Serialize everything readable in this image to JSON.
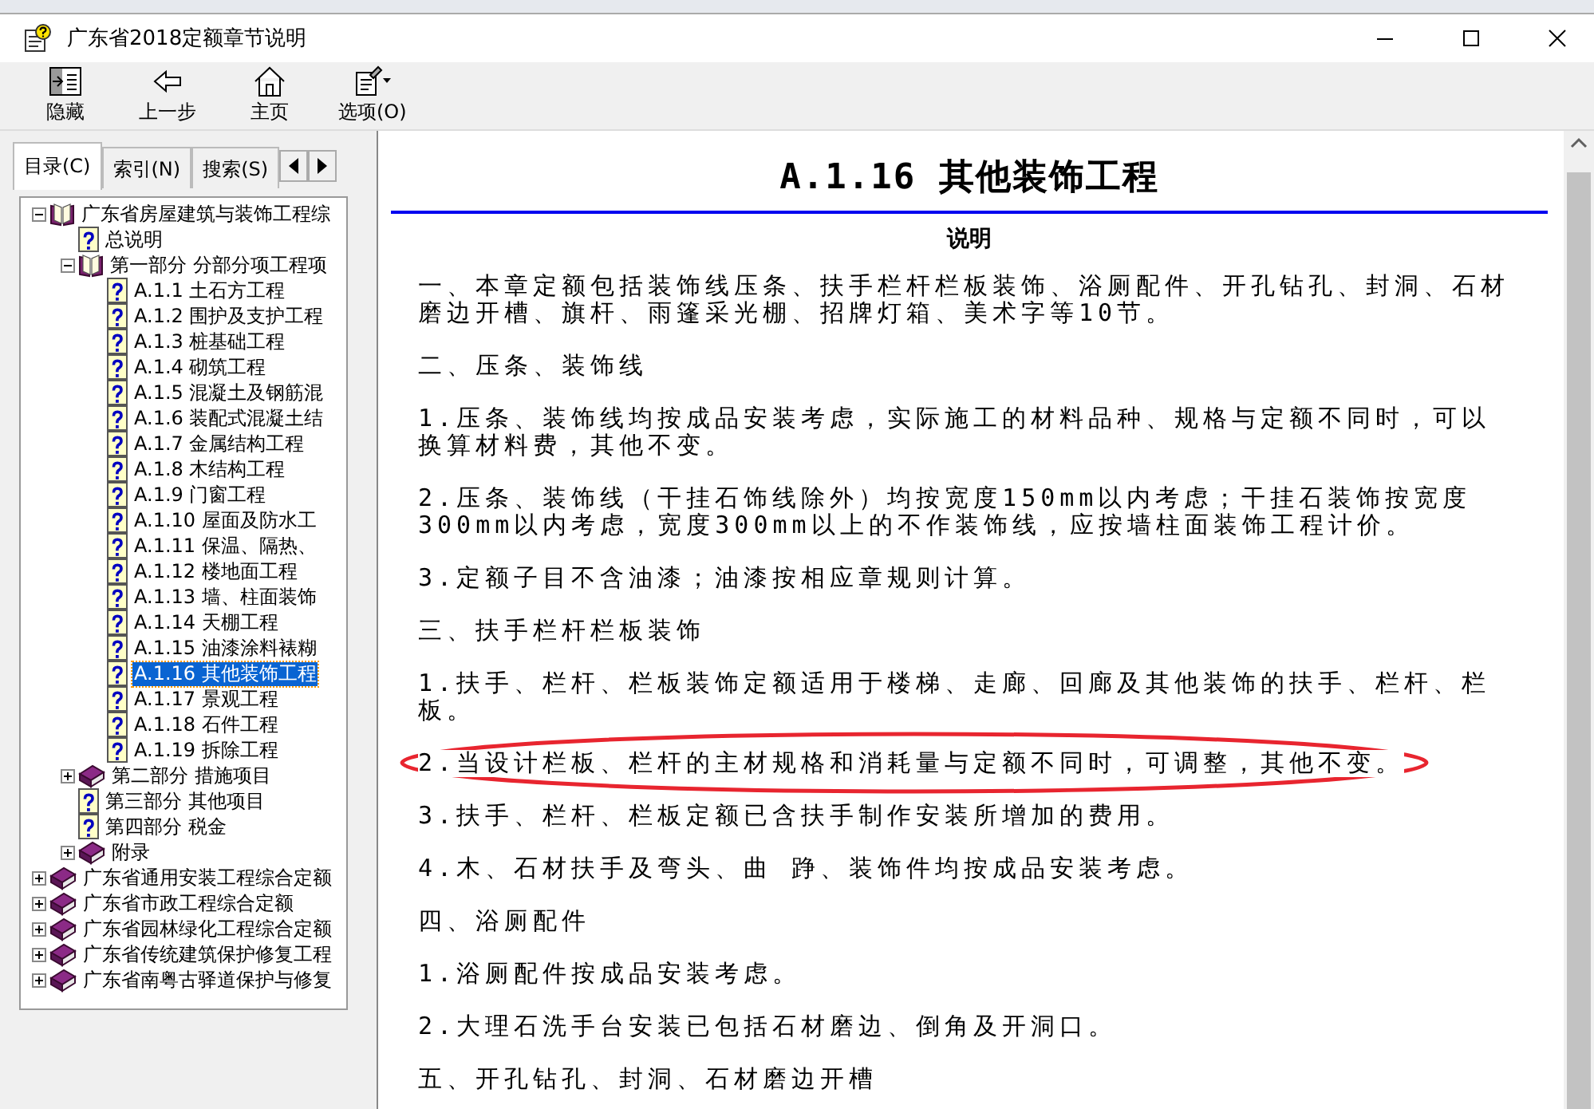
{
  "window": {
    "title": "广东省2018定额章节说明"
  },
  "toolbar": [
    {
      "label": "隐藏",
      "kind": "hide"
    },
    {
      "label": "上一步",
      "kind": "back"
    },
    {
      "label": "主页",
      "kind": "home"
    },
    {
      "label": "选项(O)",
      "kind": "options"
    }
  ],
  "tabs": [
    {
      "label": "目录(C)",
      "selected": true
    },
    {
      "label": "索引(N)",
      "selected": false
    },
    {
      "label": "搜索(S)",
      "selected": false
    }
  ],
  "tree": [
    {
      "label": "广东省房屋建筑与装饰工程综",
      "kind": "book",
      "expanded": true,
      "selected": false,
      "children": [
        {
          "label": "总说明",
          "kind": "page",
          "selected": false
        },
        {
          "label": "第一部分 分部分项工程项",
          "kind": "book",
          "expanded": true,
          "selected": false,
          "children": [
            {
              "label": "A.1.1 土石方工程",
              "kind": "page",
              "selected": false
            },
            {
              "label": "A.1.2 围护及支护工程",
              "kind": "page",
              "selected": false
            },
            {
              "label": "A.1.3 桩基础工程",
              "kind": "page",
              "selected": false
            },
            {
              "label": "A.1.4 砌筑工程",
              "kind": "page",
              "selected": false
            },
            {
              "label": "A.1.5 混凝土及钢筋混",
              "kind": "page",
              "selected": false
            },
            {
              "label": "A.1.6 装配式混凝土结",
              "kind": "page",
              "selected": false
            },
            {
              "label": "A.1.7 金属结构工程",
              "kind": "page",
              "selected": false
            },
            {
              "label": "A.1.8 木结构工程",
              "kind": "page",
              "selected": false
            },
            {
              "label": "A.1.9 门窗工程",
              "kind": "page",
              "selected": false
            },
            {
              "label": "A.1.10 屋面及防水工",
              "kind": "page",
              "selected": false
            },
            {
              "label": "A.1.11 保温、隔热、",
              "kind": "page",
              "selected": false
            },
            {
              "label": "A.1.12 楼地面工程",
              "kind": "page",
              "selected": false
            },
            {
              "label": "A.1.13 墙、柱面装饰",
              "kind": "page",
              "selected": false
            },
            {
              "label": "A.1.14 天棚工程",
              "kind": "page",
              "selected": false
            },
            {
              "label": "A.1.15 油漆涂料裱糊",
              "kind": "page",
              "selected": false
            },
            {
              "label": "A.1.16 其他装饰工程",
              "kind": "page",
              "selected": true
            },
            {
              "label": "A.1.17 景观工程",
              "kind": "page",
              "selected": false
            },
            {
              "label": "A.1.18 石件工程",
              "kind": "page",
              "selected": false
            },
            {
              "label": "A.1.19 拆除工程",
              "kind": "page",
              "selected": false
            }
          ]
        },
        {
          "label": "第二部分 措施项目",
          "kind": "book",
          "expanded": false,
          "selected": false
        },
        {
          "label": "第三部分 其他项目",
          "kind": "page",
          "selected": false
        },
        {
          "label": "第四部分 税金",
          "kind": "page",
          "selected": false
        },
        {
          "label": "附录",
          "kind": "book",
          "expanded": false,
          "selected": false
        }
      ]
    },
    {
      "label": "广东省通用安装工程综合定额",
      "kind": "book",
      "expanded": false,
      "selected": false
    },
    {
      "label": "广东省市政工程综合定额",
      "kind": "book",
      "expanded": false,
      "selected": false
    },
    {
      "label": "广东省园林绿化工程综合定额",
      "kind": "book",
      "expanded": false,
      "selected": false
    },
    {
      "label": "广东省传统建筑保护修复工程",
      "kind": "book",
      "expanded": false,
      "selected": false
    },
    {
      "label": "广东省南粤古驿道保护与修复",
      "kind": "book",
      "expanded": false,
      "selected": false
    }
  ],
  "content": {
    "title": "A.1.16 其他装饰工程",
    "subtitle": "说明",
    "paragraphs": [
      "一、本章定额包括装饰线压条、扶手栏杆栏板装饰、浴厕配件、开孔钻孔、封洞、石材磨边开槽、旗杆、雨篷采光棚、招牌灯箱、美术字等10节。",
      "二、压条、装饰线",
      "1.压条、装饰线均按成品安装考虑，实际施工的材料品种、规格与定额不同时，可以换算材料费，其他不变。",
      "2.压条、装饰线（干挂石饰线除外）均按宽度150mm以内考虑；干挂石装饰按宽度300mm以内考虑，宽度300mm以上的不作装饰线，应按墙柱面装饰工程计价。",
      "3.定额子目不含油漆；油漆按相应章规则计算。",
      "三、扶手栏杆栏板装饰",
      "1.扶手、栏杆、栏板装饰定额适用于楼梯、走廊、回廊及其他装饰的扶手、栏杆、栏板。",
      "2.当设计栏板、栏杆的主材规格和消耗量与定额不同时，可调整，其他不变。",
      "3.扶手、栏杆、栏板定额已含扶手制作安装所增加的费用。",
      "4.木、石材扶手及弯头、曲 踭、装饰件均按成品安装考虑。",
      "四、浴厕配件",
      "1.浴厕配件按成品安装考虑。",
      "2.大理石洗手台安装已包括石材磨边、倒角及开洞口。",
      "五、开孔钻孔、封洞、石材磨边开槽"
    ]
  }
}
